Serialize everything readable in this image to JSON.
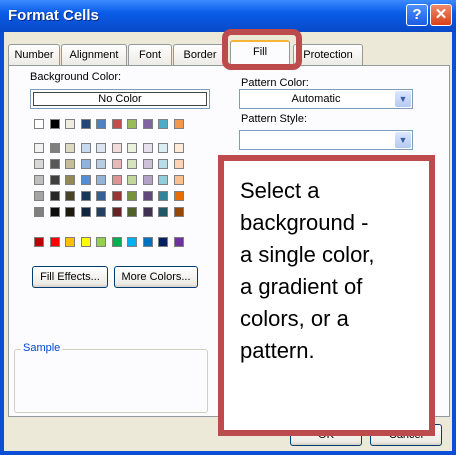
{
  "window": {
    "title": "Format Cells",
    "help_glyph": "?",
    "close_glyph": "✕"
  },
  "tabs": [
    {
      "label": "Number"
    },
    {
      "label": "Alignment"
    },
    {
      "label": "Font"
    },
    {
      "label": "Border"
    },
    {
      "label": "Fill",
      "active": true
    },
    {
      "label": "Protection"
    }
  ],
  "fill": {
    "background_color_label": "Background Color:",
    "no_color_label": "No Color",
    "pattern_color_label": "Pattern Color:",
    "pattern_color_value": "Automatic",
    "pattern_style_label": "Pattern Style:",
    "pattern_style_value": "",
    "fill_effects_label": "Fill Effects...",
    "more_colors_label": "More Colors...",
    "sample_label": "Sample"
  },
  "palette": {
    "theme_row": [
      "#ffffff",
      "#000000",
      "#eeece1",
      "#1f497d",
      "#4f81bd",
      "#c0504d",
      "#9bbb59",
      "#8064a2",
      "#4bacc6",
      "#f79646"
    ],
    "tint_rows": [
      [
        "#f2f2f2",
        "#7f7f7f",
        "#ddd9c3",
        "#c6d9f0",
        "#dbe5f1",
        "#f2dcdb",
        "#ebf1dd",
        "#e5e0ec",
        "#dbeef3",
        "#fdeada"
      ],
      [
        "#d8d8d8",
        "#595959",
        "#c4bd97",
        "#8db3e2",
        "#b8cce4",
        "#e5b9b7",
        "#d7e3bc",
        "#ccc1d9",
        "#b7dde8",
        "#fbd5b5"
      ],
      [
        "#bfbfbf",
        "#3f3f3f",
        "#938953",
        "#548dd4",
        "#95b3d7",
        "#d99694",
        "#c3d69b",
        "#b2a2c7",
        "#92cddc",
        "#fac08f"
      ],
      [
        "#a5a5a5",
        "#262626",
        "#494429",
        "#17365d",
        "#366092",
        "#953734",
        "#76923c",
        "#5f497a",
        "#31859b",
        "#e36c09"
      ],
      [
        "#7f7f7f",
        "#0c0c0c",
        "#1d1b10",
        "#0f243e",
        "#244061",
        "#632423",
        "#4f6128",
        "#3f3151",
        "#205867",
        "#974806"
      ]
    ],
    "standard_row": [
      "#c00000",
      "#ff0000",
      "#ffc000",
      "#ffff00",
      "#92d050",
      "#00b050",
      "#00b0f0",
      "#0070c0",
      "#002060",
      "#7030a0"
    ]
  },
  "buttons": {
    "ok": "OK",
    "cancel": "Cancel"
  },
  "callout": {
    "lines": [
      "Select a",
      "background -",
      "a single color,",
      "a gradient of",
      "colors, or a",
      "pattern."
    ]
  },
  "colors": {
    "annotation_red": "#bd4b4d",
    "title_blue": "#0a5ce8"
  }
}
